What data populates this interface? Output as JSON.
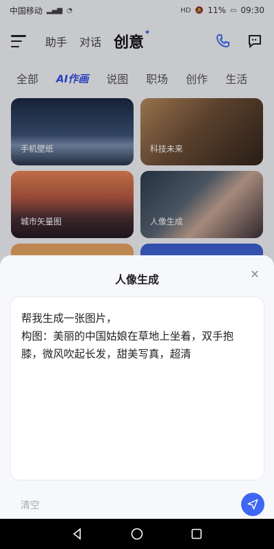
{
  "status_bar": {
    "carrier": "中国移动",
    "battery": "11%",
    "time": "09:30",
    "icons": [
      "signal-icon",
      "wifi-icon",
      "hd-icon",
      "mute-icon",
      "battery-icon"
    ]
  },
  "top_nav": {
    "tabs": [
      "助手",
      "对话",
      "创意"
    ],
    "active_tab": "创意",
    "icons": [
      "menu-icon",
      "phone-icon",
      "message-add-icon"
    ]
  },
  "categories": [
    "全部",
    "AI作画",
    "说图",
    "职场",
    "创作",
    "生活"
  ],
  "cards": [
    {
      "label": "手机壁纸"
    },
    {
      "label": "科技未来"
    },
    {
      "label": "城市矢量图"
    },
    {
      "label": "人像生成"
    }
  ],
  "sheet": {
    "title": "人像生成",
    "prompt": "帮我生成一张图片，\n构图：美丽的中国姑娘在草地上坐着，双手抱膝，微风吹起长发，甜美写真，超清",
    "clear_label": "清空"
  },
  "colors": {
    "accent": "#3f67f3"
  }
}
